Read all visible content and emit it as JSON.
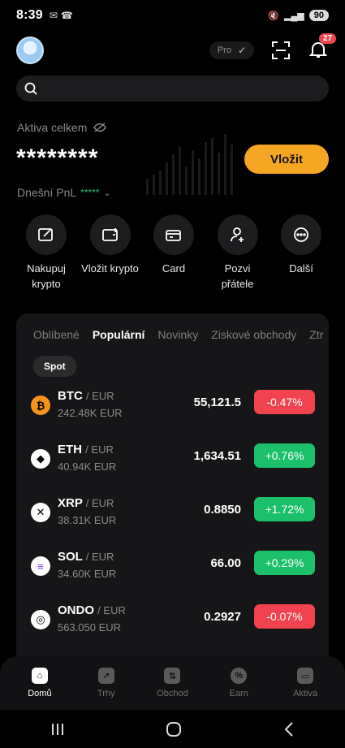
{
  "status_bar": {
    "time": "8:39",
    "battery": "90"
  },
  "header": {
    "pro_label": "Pro",
    "notification_count": "27"
  },
  "balance": {
    "label": "Aktiva celkem",
    "value": "********",
    "deposit_label": "Vložit",
    "pnl_label": "Dnešní PnL",
    "pnl_value": "*****"
  },
  "actions": [
    {
      "label": "Nakupuj\nkrypto",
      "icon": "buy-crypto-icon"
    },
    {
      "label": "Vložit krypto",
      "icon": "deposit-wallet-icon"
    },
    {
      "label": "Card",
      "icon": "card-icon"
    },
    {
      "label": "Pozvi\npřátele",
      "icon": "invite-icon"
    },
    {
      "label": "Další",
      "icon": "more-icon"
    }
  ],
  "market": {
    "tabs": [
      "Oblíbené",
      "Populární",
      "Novinky",
      "Ziskové obchody",
      "Ztr"
    ],
    "active_tab": "Populární",
    "filter": "Spot",
    "rows": [
      {
        "symbol": "BTC",
        "quote": "/ EUR",
        "volume": "242.48K EUR",
        "price": "55,121.5",
        "change": "-0.47%",
        "direction": "down",
        "icon_color": "#f7931a"
      },
      {
        "symbol": "ETH",
        "quote": "/ EUR",
        "volume": "40.94K EUR",
        "price": "1,634.51",
        "change": "+0.76%",
        "direction": "up",
        "icon_color": "#ffffff"
      },
      {
        "symbol": "XRP",
        "quote": "/ EUR",
        "volume": "38.31K EUR",
        "price": "0.8850",
        "change": "+1.72%",
        "direction": "up",
        "icon_color": "#ffffff"
      },
      {
        "symbol": "SOL",
        "quote": "/ EUR",
        "volume": "34.60K EUR",
        "price": "66.00",
        "change": "+0.29%",
        "direction": "up",
        "icon_color": "#ffffff"
      },
      {
        "symbol": "ONDO",
        "quote": "/ EUR",
        "volume": "563.050 EUR",
        "price": "0.2927",
        "change": "-0.07%",
        "direction": "down",
        "icon_color": "#ffffff"
      }
    ]
  },
  "bottom_nav": [
    {
      "label": "Domů",
      "active": true
    },
    {
      "label": "Trhy",
      "active": false
    },
    {
      "label": "Obchod",
      "active": false
    },
    {
      "label": "Earn",
      "active": false
    },
    {
      "label": "Aktiva",
      "active": false
    }
  ],
  "colors": {
    "accent": "#f5a623",
    "positive": "#1dc06a",
    "negative": "#f0434f",
    "background": "#000000"
  }
}
